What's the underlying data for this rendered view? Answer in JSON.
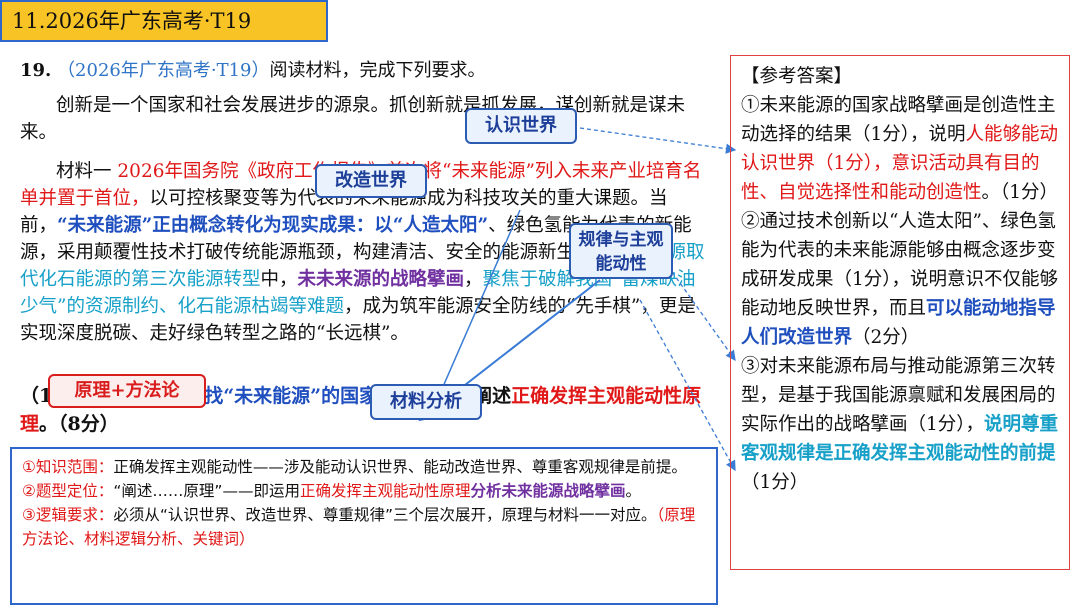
{
  "banner": {
    "title": "11.2026年广东高考·T19"
  },
  "question": {
    "number": "19.",
    "source": "（2026年广东高考·T19）",
    "instruction": "阅读材料，完成下列要求。"
  },
  "passage": {
    "p1": "创新是一个国家和社会发展进步的源泉。抓创新就是抓发展，谋创新就是谋未来。",
    "p2_prefix": "材料一",
    "p2_red": "2026年国务院《政府工作报告》首次将“未来能源”列入未来产业培育名单并置于首位，",
    "p2_plain1": "以可控核聚变等为代表的未来能源成为科技攻关的重大课题。当前，",
    "p2_blue1": "“未来能源”正由概念转化为现实成果：以“人造太阳”",
    "p2_plain2": "、绿色氢能为代表的新能源，采用颠覆性技术打破传统能源瓶颈，构建清洁、安全的能源新生态。",
    "p2_cyan1": "在新能源取代化石能源的第三次能源转型",
    "p2_plain3": "中，",
    "p2_purple": "未未来源的战略擘画",
    "p2_plain4": "，",
    "p2_cyan2": "聚焦于破解我国“富煤缺油少气”的资源制约、化石能源枯竭等难题",
    "p2_plain5": "，成为筑牢能源安全防线的“先手棋”，更是实现深度脱碳、走好绿色转型之路的“长远棋”。"
  },
  "requirement": {
    "prefix": "（1）结合材料，",
    "bold1": "就",
    "blue": "寻找“未来能源”的国家战略擘画",
    "plain": "，阐述",
    "red": "正确发挥主观能动性原理",
    "suffix": "。（8分）"
  },
  "tags": {
    "recognize": "认识世界",
    "transform": "改造世界",
    "law": "规律与主观能动性",
    "principle": "原理+方法论",
    "material": "材料分析",
    "overlay_arrow_text": "能源的战略擘画"
  },
  "answer": {
    "header": "【参考答案】",
    "a1_plain1": "①未来能源的国家战略擘画是创造性主动选择的结果（1分），说明",
    "a1_red": "人能够能动认识世界（1分），意识活动具有目的性、自觉选择性和能动创造性",
    "a1_plain2": "。（1分）",
    "a2_plain1": "②通过技术创新以“人造太阳”、绿色氢能为代表的未来能源能够由概念逐步变成研发成果（1分），说明意识不仅能够能动地反映世界，而且",
    "a2_blue": "可以能动地指导人们改造世界",
    "a2_plain2": "（2分）",
    "a3_plain1": "③对未来能源布局与推动能源第三次转型，是基于我国能源禀赋和发展困局的实际作出的战略擘画（1分），",
    "a3_cyan": "说明尊重客观规律是正确发挥主观能动性的前提",
    "a3_plain2": "（1分）"
  },
  "analysis": {
    "l1_label": "①知识范围：",
    "l1_text": "正确发挥主观能动性——涉及能动认识世界、能动改造世界、尊重客观规律是前提。",
    "l2_label": "②题型定位：",
    "l2_text1": "“阐述……原理”——即运用",
    "l2_red": "正确发挥主观能动性原理",
    "l2_purple": "分析未来能源战略擘画",
    "l2_text2": "。",
    "l3_label": "③逻辑要求：",
    "l3_text": "必须从“认识世界、改造世界、尊重规律”三个层次展开，原理与材料一一对应。",
    "l3_red": "（原理方法论、材料逻辑分析、关键词）"
  },
  "colors": {
    "banner_bg": "#f7c325",
    "accent_blue": "#2e67c9",
    "red": "#e01818",
    "cyan": "#17a0c8",
    "purple": "#7030a0"
  }
}
